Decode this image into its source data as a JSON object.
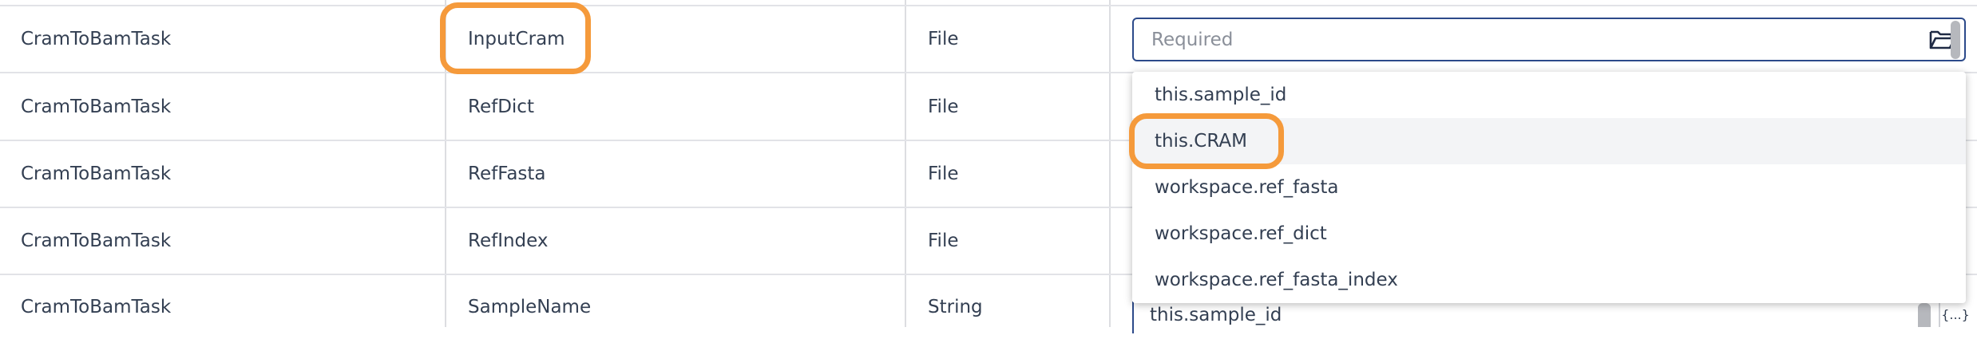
{
  "rows": [
    {
      "task": "CramToBamTask",
      "variable": "InputCram",
      "type": "File"
    },
    {
      "task": "CramToBamTask",
      "variable": "RefDict",
      "type": "File"
    },
    {
      "task": "CramToBamTask",
      "variable": "RefFasta",
      "type": "File"
    },
    {
      "task": "CramToBamTask",
      "variable": "RefIndex",
      "type": "File"
    },
    {
      "task": "CramToBamTask",
      "variable": "SampleName",
      "type": "String"
    }
  ],
  "attribute_input": {
    "placeholder": "Required",
    "value": "",
    "icon": "folder-open-icon"
  },
  "dropdown": {
    "options": [
      "this.sample_id",
      "this.CRAM",
      "workspace.ref_fasta",
      "workspace.ref_dict",
      "workspace.ref_fasta_index"
    ],
    "highlighted": "this.CRAM"
  },
  "last_row_value": "this.sample_id",
  "last_row_button": "{...}",
  "colors": {
    "highlight": "#f59a3b",
    "input_border": "#2c4a8a",
    "text": "#333f52",
    "placeholder": "#8a8f99"
  }
}
